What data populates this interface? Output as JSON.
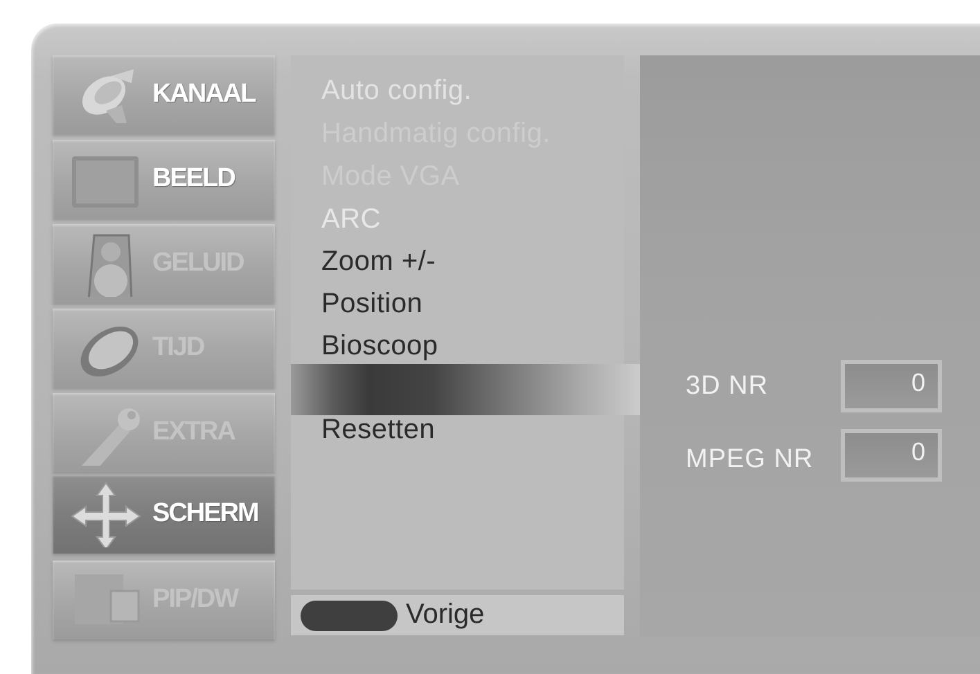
{
  "menu": {
    "items": [
      {
        "label": "KANAAL",
        "icon": "satellite-dish-icon"
      },
      {
        "label": "BEELD",
        "icon": "picture-icon"
      },
      {
        "label": "GELUID",
        "icon": "speaker-icon"
      },
      {
        "label": "TIJD",
        "icon": "clock-icon"
      },
      {
        "label": "EXTRA",
        "icon": "wrench-icon"
      },
      {
        "label": "SCHERM",
        "icon": "move-arrows-icon"
      },
      {
        "label": "PIP/DW",
        "icon": "pip-icon"
      }
    ],
    "selected": "SCHERM"
  },
  "submenu": {
    "items": [
      "Auto config.",
      "Handmatig config.",
      "Mode VGA",
      "ARC",
      "Zoom +/-",
      "Position",
      "Bioscoop",
      "Resetten"
    ],
    "back_label": "Vorige"
  },
  "panel": {
    "nr3d_label": "3D NR",
    "nr3d_value": "0",
    "mpeg_label": "MPEG NR",
    "mpeg_value": "0"
  }
}
